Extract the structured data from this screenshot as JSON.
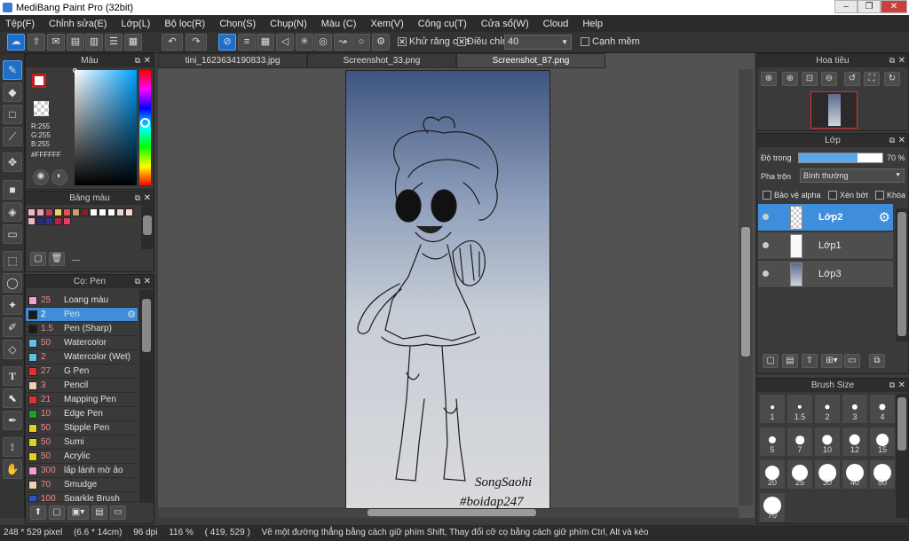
{
  "window": {
    "title": "MediBang Paint Pro (32bit)"
  },
  "menu": [
    "Tệp(F)",
    "Chỉnh sửa(E)",
    "Lớp(L)",
    "Bộ lọc(R)",
    "Chọn(S)",
    "Chụp(N)",
    "Màu (C)",
    "Xem(V)",
    "Công cụ(T)",
    "Cửa sổ(W)",
    "Cloud",
    "Help"
  ],
  "toolbar": {
    "antialias_label": "Khử răng cưa",
    "correction_label": "Điều chỉnh",
    "correction_value": "40",
    "smooth_edge_label": "Cạnh mềm"
  },
  "color_panel": {
    "title": "Màu",
    "r": "R:255",
    "g": "G:255",
    "b": "B:255",
    "hex": "#FFFFFF",
    "fg": "#ffffff",
    "bg": "#1a2a6c"
  },
  "palette_panel": {
    "title": "Bảng màu",
    "footer": "---",
    "swatches": [
      "#f4b6c2",
      "#e9a0b0",
      "#c8385a",
      "#f0d060",
      "#e35050",
      "#c8a070",
      "#8a1e28",
      "#ffffff",
      "#ffffff",
      "#f4d0d0",
      "#f8d8c8",
      "#ffffff",
      "#f4b6c2",
      "#2a2a80",
      "#303090",
      "#c02040",
      "#e04060"
    ]
  },
  "brush_panel": {
    "title": "Cọ: Pen",
    "items": [
      {
        "size": "25",
        "name": "Loang màu",
        "color": "#f4a0c8"
      },
      {
        "size": "2",
        "name": "Pen",
        "color": "#1a1a1a"
      },
      {
        "size": "1.5",
        "name": "Pen (Sharp)",
        "color": "#1a1a1a"
      },
      {
        "size": "50",
        "name": "Watercolor",
        "color": "#60c0e0"
      },
      {
        "size": "2",
        "name": "Watercolor (Wet)",
        "color": "#60c0e0"
      },
      {
        "size": "27",
        "name": "G Pen",
        "color": "#e03030"
      },
      {
        "size": "3",
        "name": "Pencil",
        "color": "#f0d0b0"
      },
      {
        "size": "21",
        "name": "Mapping Pen",
        "color": "#e03030"
      },
      {
        "size": "10",
        "name": "Edge Pen",
        "color": "#20a020"
      },
      {
        "size": "50",
        "name": "Stipple Pen",
        "color": "#e0d020"
      },
      {
        "size": "50",
        "name": "Sumi",
        "color": "#e0d020"
      },
      {
        "size": "50",
        "name": "Acrylic",
        "color": "#e0d020"
      },
      {
        "size": "300",
        "name": "lấp lánh mờ ảo",
        "color": "#f4a0c8"
      },
      {
        "size": "70",
        "name": "Smudge",
        "color": "#f0d0b0"
      },
      {
        "size": "100",
        "name": "Sparkle Brush",
        "color": "#3050c0"
      }
    ]
  },
  "tabs": [
    "tini_1623634190833.jpg",
    "Screenshot_33.png",
    "Screenshot_87.png"
  ],
  "canvas": {
    "signature_line1": "SongSaohi",
    "signature_line2": "#boidap247"
  },
  "navigator": {
    "title": "Hoa tiêu"
  },
  "layer_panel": {
    "title": "Lớp",
    "opacity_label": "Độ trong",
    "opacity_value": "70 %",
    "opacity_fraction": 0.7,
    "blend_label": "Pha trộn",
    "blend_value": "Bình thường",
    "protect_alpha": "Bảo vệ alpha",
    "clipping": "Xén bớt",
    "lock": "Khóa",
    "layers": [
      {
        "name": "Lớp2"
      },
      {
        "name": "Lớp1"
      },
      {
        "name": "Lớp3"
      }
    ]
  },
  "brush_size_panel": {
    "title": "Brush Size",
    "sizes": [
      "1",
      "1.5",
      "2",
      "3",
      "4",
      "5",
      "7",
      "10",
      "12",
      "15",
      "20",
      "25",
      "30",
      "40",
      "50",
      "70"
    ]
  },
  "status": {
    "dimensions": "248 * 529 pixel",
    "physical": "(6.6 * 14cm)",
    "dpi": "96 dpi",
    "zoom": "116 %",
    "coords": "( 419, 529 )",
    "hint": "Vẽ một đường thẳng bằng cách giữ phím Shift, Thay đổi cỡ cọ bằng cách giữ phím Ctrl, Alt và kéo"
  }
}
